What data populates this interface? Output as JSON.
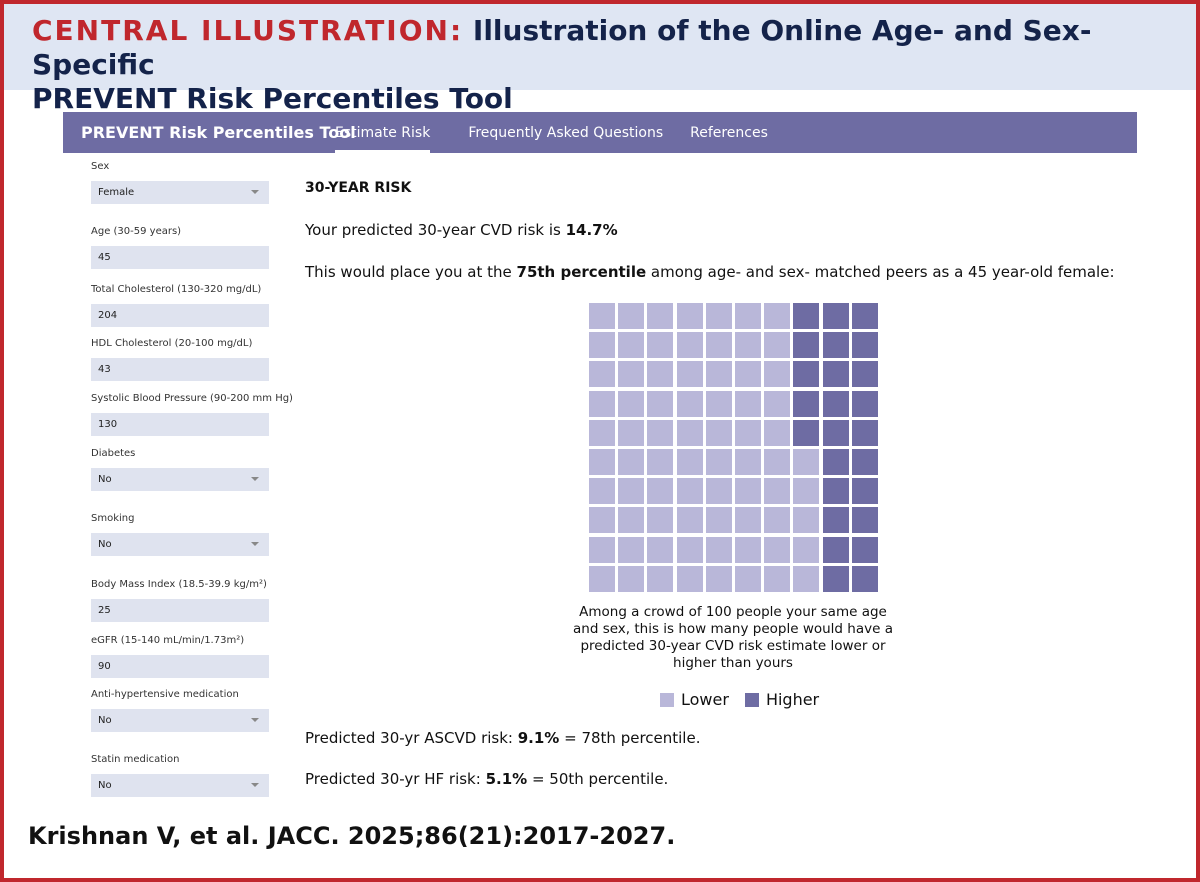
{
  "header": {
    "label": "CENTRAL ILLUSTRATION:",
    "title_line1": "Illustration of the Online Age- and Sex-Specific",
    "title_line2": "PREVENT Risk Percentiles Tool"
  },
  "nav": {
    "brand": "PREVENT Risk Percentiles Tool",
    "tabs": [
      {
        "label": "Estimate Risk",
        "active": true
      },
      {
        "label": "Frequently Asked Questions",
        "active": false
      },
      {
        "label": "References",
        "active": false
      }
    ]
  },
  "form": {
    "fields": [
      {
        "label": "Sex",
        "value": "Female",
        "type": "select"
      },
      {
        "label": "Age (30-59 years)",
        "value": "45",
        "type": "input"
      },
      {
        "label": "Total Cholesterol (130-320 mg/dL)",
        "value": "204",
        "type": "input"
      },
      {
        "label": "HDL Cholesterol (20-100 mg/dL)",
        "value": "43",
        "type": "input"
      },
      {
        "label": "Systolic Blood Pressure (90-200 mm Hg)",
        "value": "130",
        "type": "input"
      },
      {
        "label": "Diabetes",
        "value": "No",
        "type": "select"
      },
      {
        "label": "Smoking",
        "value": "No",
        "type": "select"
      },
      {
        "label": "Body Mass Index (18.5-39.9 kg/m²)",
        "value": "25",
        "type": "input"
      },
      {
        "label": "eGFR (15-140 mL/min/1.73m²)",
        "value": "90",
        "type": "input"
      },
      {
        "label": "Anti-hypertensive medication",
        "value": "No",
        "type": "select"
      },
      {
        "label": "Statin medication",
        "value": "No",
        "type": "select"
      }
    ]
  },
  "results": {
    "section_title": "30-YEAR RISK",
    "predicted_prefix": "Your predicted 30-year CVD risk is ",
    "predicted_value": "14.7%",
    "percentile_prefix": "This would place you at the ",
    "percentile_value": "75th percentile",
    "percentile_suffix": " among age- and sex- matched peers as a 45 year-old female:",
    "caption": "Among a crowd of 100 people your same age and sex, this is how many people would have a predicted 30-year CVD risk estimate lower or higher than yours",
    "legend_lower": "Lower",
    "legend_higher": "Higher",
    "ascvd_prefix": "Predicted 30-yr ASCVD risk: ",
    "ascvd_value": "9.1%",
    "ascvd_suffix": " = 78th percentile.",
    "hf_prefix": "Predicted 30-yr HF risk: ",
    "hf_value": "5.1%",
    "hf_suffix": " = 50th percentile."
  },
  "waffle": {
    "total": 100,
    "lower_count": 75,
    "higher_count": 25,
    "lower_color": "#b9b7d9",
    "higher_color": "#6e6ca3"
  },
  "colors": {
    "accent_red": "#c0272d",
    "navbar": "#6e6ca3",
    "header_bg": "#dfe6f3",
    "title_navy": "#14234a"
  },
  "citation": "Krishnan V, et al. JACC. 2025;86(21):2017-2027."
}
